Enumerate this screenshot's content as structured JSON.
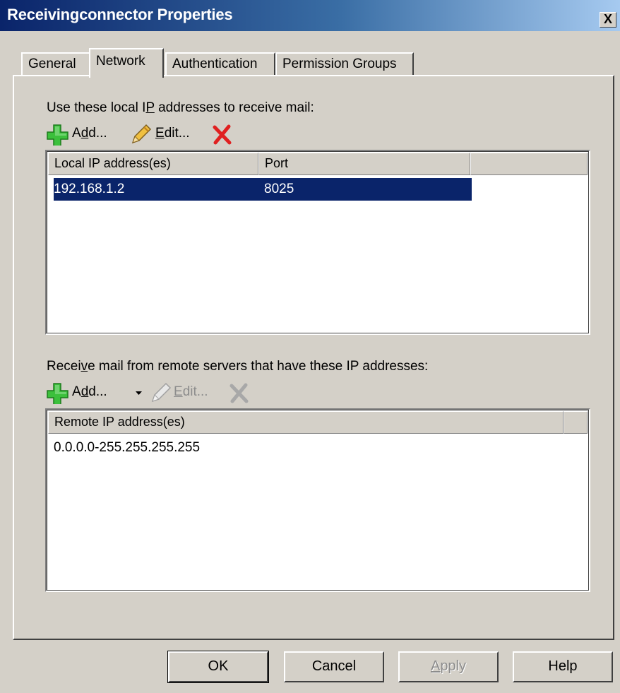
{
  "window": {
    "title": "Receivingconnector Properties",
    "close_glyph": "X"
  },
  "tabs": [
    {
      "label": "General",
      "active": false
    },
    {
      "label": "Network",
      "active": true
    },
    {
      "label": "Authentication",
      "active": false
    },
    {
      "label": "Permission Groups",
      "active": false
    }
  ],
  "local": {
    "label_pre": "Use these local I",
    "label_accel": "P",
    "label_post": " addresses to receive mail:",
    "add_pre": "A",
    "add_accel": "d",
    "add_post": "d...",
    "edit_accel": "E",
    "edit_post": "dit...",
    "columns": [
      "Local IP address(es)",
      "Port"
    ],
    "rows": [
      {
        "ip": "192.168.1.2",
        "port": "8025",
        "selected": true
      }
    ]
  },
  "remote": {
    "label_pre": "Recei",
    "label_accel": "v",
    "label_post": "e mail from remote servers that have these IP addresses:",
    "add_pre": "A",
    "add_accel": "d",
    "add_post": "d...",
    "edit_accel": "E",
    "edit_post": "dit...",
    "columns": [
      "Remote IP address(es)"
    ],
    "rows": [
      {
        "range": "0.0.0.0-255.255.255.255"
      }
    ]
  },
  "buttons": {
    "ok": "OK",
    "cancel": "Cancel",
    "apply_accel": "A",
    "apply_post": "pply",
    "help": "Help"
  },
  "colors": {
    "selection": "#0a246a",
    "dialog_bg": "#d4d0c8",
    "add_icon": "#3cc03c",
    "delete_icon": "#e02020"
  },
  "icons": {
    "add": "green-plus-icon",
    "edit": "pencil-icon",
    "delete": "red-x-icon",
    "dropdown": "dropdown-arrow-icon"
  }
}
